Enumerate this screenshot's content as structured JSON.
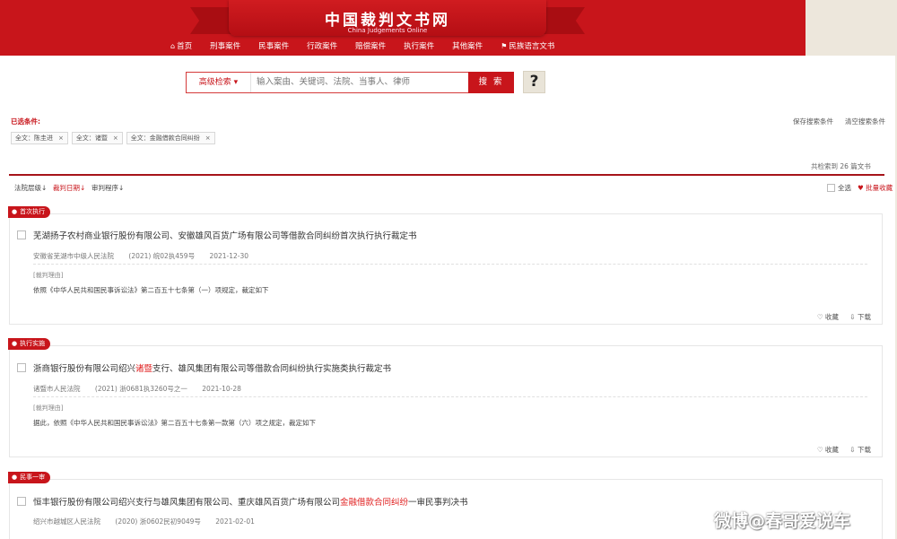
{
  "header": {
    "site_title": "中国裁判文书网",
    "site_subtitle": "China Judgements Online",
    "nav": [
      {
        "label": "首页",
        "icon": "home-icon"
      },
      {
        "label": "刑事案件"
      },
      {
        "label": "民事案件"
      },
      {
        "label": "行政案件"
      },
      {
        "label": "赔偿案件"
      },
      {
        "label": "执行案件"
      },
      {
        "label": "其他案件"
      },
      {
        "label": "民族语言文书",
        "icon": "flag-icon"
      }
    ]
  },
  "search": {
    "advanced_label": "高级检索",
    "placeholder": "输入案由、关键词、法院、当事人、律师",
    "button_label": "搜 索",
    "help_label": "?"
  },
  "conditions": {
    "label": "已选条件:",
    "save_label": "保存搜索条件",
    "clear_label": "清空搜索条件",
    "chips": [
      "全文：陈圭进",
      "全文：诸暨",
      "全文：金融借款合同纠纷"
    ]
  },
  "results": {
    "total_text": "共检索到 26 篇文书",
    "sort_options": [
      {
        "label": "法院层级↓",
        "active": false
      },
      {
        "label": "裁判日期↓",
        "active": true
      },
      {
        "label": "审判程序↓",
        "active": false
      }
    ],
    "select_all_label": "全选",
    "bulk_collect_label": "批量收藏"
  },
  "cards": [
    {
      "tag": "首次执行",
      "title_parts": [
        {
          "text": "芜湖扬子农村商业银行股份有限公司、安徽雄风百货广场有限公司等借款合同纠纷首次执行执行裁定书",
          "hl": false
        }
      ],
      "court": "安徽省芜湖市中级人民法院",
      "case_no": "(2021) 皖02执459号",
      "date": "2021-12-30",
      "reason_label": "[裁判理由]",
      "reason": "依照《中华人民共和国民事诉讼法》第二百五十七条第（一）项规定，裁定如下",
      "collect_label": "♡ 收藏",
      "download_label": "⇩ 下载"
    },
    {
      "tag": "执行实施",
      "title_parts": [
        {
          "text": "浙商银行股份有限公司绍兴",
          "hl": false
        },
        {
          "text": "诸暨",
          "hl": true
        },
        {
          "text": "支行、雄风集团有限公司等借款合同纠纷执行实施类执行裁定书",
          "hl": false
        }
      ],
      "court": "诸暨市人民法院",
      "case_no": "(2021) 浙0681执3260号之一",
      "date": "2021-10-28",
      "reason_label": "[裁判理由]",
      "reason": "据此，依照《中华人民共和国民事诉讼法》第二百五十七条第一款第（六）项之规定，裁定如下",
      "collect_label": "♡ 收藏",
      "download_label": "⇩ 下载"
    },
    {
      "tag": "民事一审",
      "title_parts": [
        {
          "text": "恒丰银行股份有限公司绍兴支行与雄风集团有限公司、重庆雄风百货广场有限公司",
          "hl": false
        },
        {
          "text": "金融借款合同纠纷",
          "hl": true
        },
        {
          "text": "一审民事判决书",
          "hl": false
        }
      ],
      "court": "绍兴市越城区人民法院",
      "case_no": "(2020) 浙0602民初9049号",
      "date": "2021-02-01"
    }
  ],
  "watermark": "微博@春哥爱说车"
}
